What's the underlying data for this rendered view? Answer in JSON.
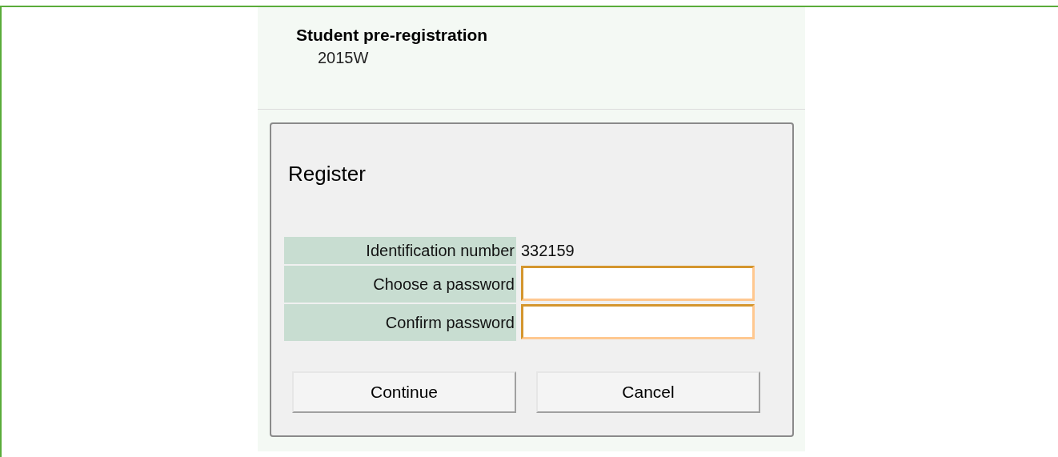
{
  "header": {
    "title": "Student pre-registration",
    "term": "2015W"
  },
  "dialog": {
    "title": "Register",
    "fields": [
      {
        "kind": "text",
        "label": "Identification number",
        "value": "332159"
      },
      {
        "kind": "input",
        "label": "Choose a password"
      },
      {
        "kind": "input",
        "label": "Confirm password"
      }
    ],
    "buttons": [
      "Continue",
      "Cancel"
    ]
  }
}
